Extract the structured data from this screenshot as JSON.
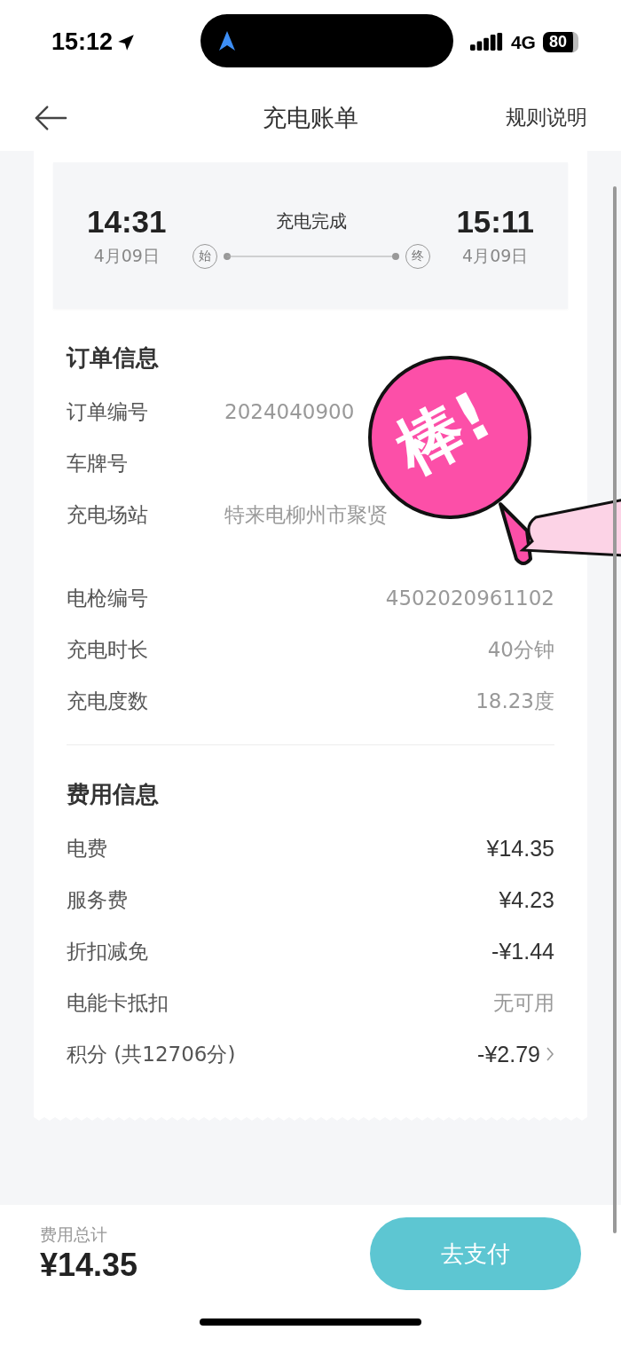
{
  "status_bar": {
    "time": "15:12",
    "network": "4G",
    "battery": "80"
  },
  "nav": {
    "title": "充电账单",
    "action": "规则说明"
  },
  "session": {
    "start_time": "14:31",
    "start_date": "4月09日",
    "start_tag": "始",
    "status": "充电完成",
    "end_time": "15:11",
    "end_date": "4月09日",
    "end_tag": "终"
  },
  "order_info": {
    "title": "订单信息",
    "rows": [
      {
        "label": "订单编号",
        "value": "2024040900",
        "kind": "covered"
      },
      {
        "label": "车牌号",
        "kind": "single"
      },
      {
        "label": "充电场站",
        "value": "特来电柳州市聚贤",
        "kind": "covered_multiline"
      },
      {
        "label": "电枪编号",
        "value": "4502020961102",
        "kind": "single"
      },
      {
        "label": "充电时长",
        "value": "40分钟",
        "kind": "single"
      },
      {
        "label": "充电度数",
        "value": "18.23度",
        "kind": "single"
      }
    ]
  },
  "fee_info": {
    "title": "费用信息",
    "rows": [
      {
        "label": "电费",
        "value": "¥14.35",
        "kind": "amount"
      },
      {
        "label": "服务费",
        "value": "¥4.23",
        "kind": "amount"
      },
      {
        "label": "折扣减免",
        "value": "-¥1.44",
        "kind": "amount"
      },
      {
        "label": "电能卡抵扣",
        "value": "无可用",
        "kind": "note"
      },
      {
        "label": "积分 (共12706分)",
        "value": "-¥2.79",
        "kind": "link"
      }
    ]
  },
  "sticker": {
    "text": "棒!"
  },
  "footer": {
    "total_label": "费用总计",
    "total": "¥14.35",
    "pay_button": "去支付"
  }
}
